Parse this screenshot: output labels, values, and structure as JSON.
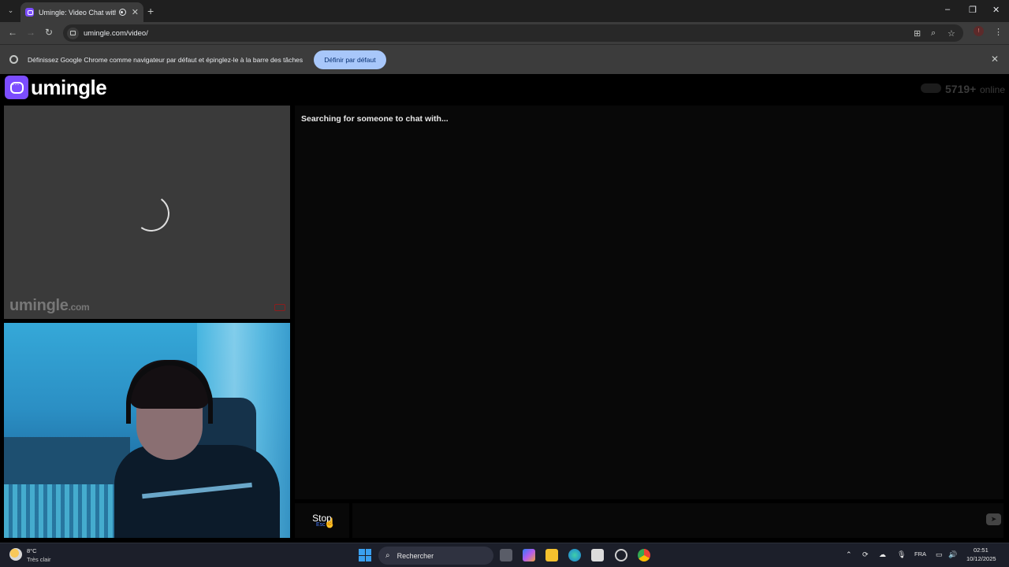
{
  "browser": {
    "tab_title": "Umingle: Video Chat with S",
    "tab_close": "✕",
    "new_tab": "+",
    "url": "umingle.com/video/",
    "window_controls": {
      "minimize": "–",
      "restore": "❐",
      "close": "✕"
    }
  },
  "infobar": {
    "message": "Définissez Google Chrome comme navigateur par défaut et épinglez-le à la barre des tâches",
    "button_label": "Définir par défaut",
    "close": "✕"
  },
  "site": {
    "logo_text": "umingle",
    "online_count": "5719+",
    "online_label": "online",
    "watermark": "umingle",
    "watermark_suffix": ".com",
    "status_message": "Searching for someone to chat with...",
    "stop_label": "Stop",
    "stop_hint": "Esc",
    "chat_input_placeholder": ""
  },
  "taskbar": {
    "temperature": "8°C",
    "condition": "Très clair",
    "search_placeholder": "Rechercher",
    "language": "FRA",
    "time": "02:51",
    "date": "10/12/2025"
  },
  "colors": {
    "brand": "#7c4dff",
    "default_button": "#a8c7fa",
    "page_bg": "#000000"
  }
}
